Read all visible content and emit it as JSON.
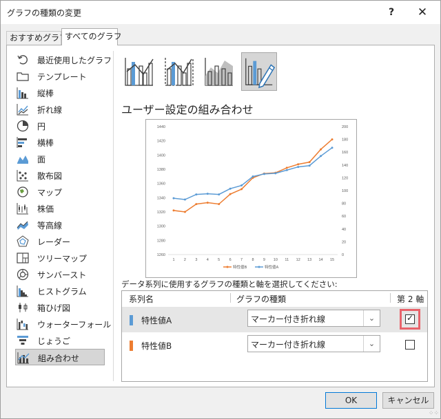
{
  "dialog": {
    "title": "グラフの種類の変更",
    "help": "?",
    "close": "✕"
  },
  "tabs": [
    {
      "label": "おすすめグラフ",
      "selected": false
    },
    {
      "label": "すべてのグラフ",
      "selected": true
    }
  ],
  "sidebar": {
    "items": [
      {
        "label": "最近使用したグラフ",
        "icon": "recent-icon"
      },
      {
        "label": "テンプレート",
        "icon": "folder-icon"
      },
      {
        "label": "縦棒",
        "icon": "column-chart-icon"
      },
      {
        "label": "折れ線",
        "icon": "line-chart-icon"
      },
      {
        "label": "円",
        "icon": "pie-chart-icon"
      },
      {
        "label": "横棒",
        "icon": "bar-chart-icon"
      },
      {
        "label": "面",
        "icon": "area-chart-icon"
      },
      {
        "label": "散布図",
        "icon": "scatter-chart-icon"
      },
      {
        "label": "マップ",
        "icon": "map-chart-icon"
      },
      {
        "label": "株価",
        "icon": "stock-chart-icon"
      },
      {
        "label": "等高線",
        "icon": "surface-chart-icon"
      },
      {
        "label": "レーダー",
        "icon": "radar-chart-icon"
      },
      {
        "label": "ツリーマップ",
        "icon": "treemap-chart-icon"
      },
      {
        "label": "サンバースト",
        "icon": "sunburst-chart-icon"
      },
      {
        "label": "ヒストグラム",
        "icon": "histogram-chart-icon"
      },
      {
        "label": "箱ひげ図",
        "icon": "box-whisker-chart-icon"
      },
      {
        "label": "ウォーターフォール",
        "icon": "waterfall-chart-icon"
      },
      {
        "label": "じょうご",
        "icon": "funnel-chart-icon"
      },
      {
        "label": "組み合わせ",
        "icon": "combo-chart-icon",
        "selected": true
      }
    ]
  },
  "subtypes": [
    {
      "icon": "clustered-column-line-icon"
    },
    {
      "icon": "clustered-column-line-secondary-icon"
    },
    {
      "icon": "stacked-area-column-icon"
    },
    {
      "icon": "custom-combination-icon",
      "selected": true
    }
  ],
  "section_title": "ユーザー設定の組み合わせ",
  "chart_data": {
    "type": "line",
    "x": [
      1,
      2,
      3,
      4,
      5,
      6,
      7,
      8,
      9,
      10,
      11,
      12,
      13,
      14,
      15
    ],
    "primary_axis": {
      "ylim": [
        1260,
        1440
      ],
      "ticks": [
        1260,
        1280,
        1300,
        1320,
        1340,
        1360,
        1380,
        1400,
        1420,
        1440
      ]
    },
    "secondary_axis": {
      "ylim": [
        0,
        200
      ],
      "ticks": [
        0,
        20,
        40,
        60,
        80,
        100,
        120,
        140,
        160,
        180,
        200
      ]
    },
    "series": [
      {
        "name": "特性値B",
        "axis": "primary",
        "color": "#ed7d31",
        "values": [
          1322,
          1320,
          1331,
          1333,
          1331,
          1345,
          1352,
          1368,
          1374,
          1375,
          1382,
          1387,
          1390,
          1408,
          1422
        ]
      },
      {
        "name": "特性値A",
        "axis": "secondary",
        "color": "#5b9bd5",
        "values": [
          88,
          86,
          94,
          95,
          94,
          103,
          108,
          122,
          126,
          127,
          132,
          137,
          139,
          154,
          167
        ]
      }
    ],
    "legend_position": "bottom",
    "grid": false
  },
  "instruction": "データ系列に使用するグラフの種類と軸を選択してください:",
  "table": {
    "headers": {
      "name": "系列名",
      "type": "グラフの種類",
      "secondary": "第 2 軸"
    },
    "rows": [
      {
        "name": "特性値A",
        "color": "#5b9bd5",
        "chart_type": "マーカー付き折れ線",
        "secondary_axis": true
      },
      {
        "name": "特性値B",
        "color": "#ed7d31",
        "chart_type": "マーカー付き折れ線",
        "secondary_axis": false
      }
    ]
  },
  "buttons": {
    "ok": "OK",
    "cancel": "キャンセル"
  },
  "colors": {
    "accent": "#0078d7",
    "highlight": "#e8636b",
    "blue_series": "#5b9bd5",
    "orange_series": "#ed7d31"
  }
}
